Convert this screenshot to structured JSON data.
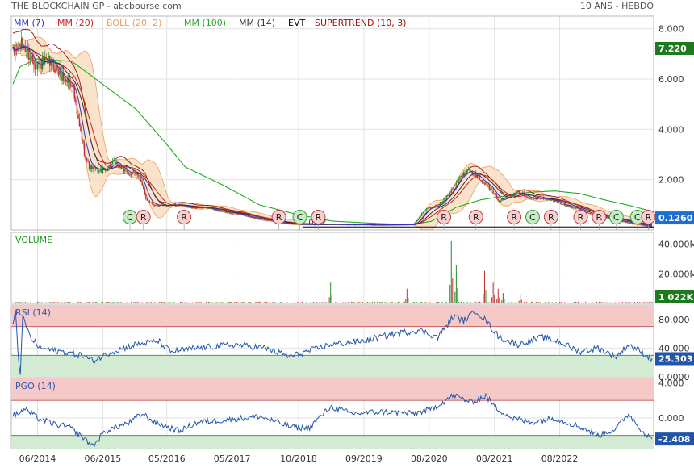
{
  "header": {
    "title": "THE BLOCKCHAIN GP - abcbourse.com",
    "period": "10 ANS - HEBDO"
  },
  "colors": {
    "mm7": "#3333cc",
    "mm20": "#cc2222",
    "boll": "#e8a060",
    "boll_fill": "#f7d9b8",
    "mm100": "#22aa22",
    "mm14": "#333333",
    "evt": "#000000",
    "supertrend": "#991111",
    "price_up": "#2a8a2a",
    "price_down": "#c03030",
    "rsi": "#2255aa",
    "pgo": "#2255aa",
    "zone_top": "#f6c9c9",
    "zone_bottom": "#d3ebd3",
    "last_price_bg": "#1f6fd1",
    "ma_tag_bg": "#1e7a1e"
  },
  "chart_data": [
    {
      "type": "line",
      "name": "price",
      "legend": [
        {
          "label": "MM (7)",
          "key": "mm7"
        },
        {
          "label": "MM (20)",
          "key": "mm20"
        },
        {
          "label": "BOLL (20, 2)",
          "key": "boll"
        },
        {
          "label": "MM (100)",
          "key": "mm100"
        },
        {
          "label": "MM (14)",
          "key": "mm14"
        },
        {
          "label": "EVT",
          "key": "evt"
        },
        {
          "label": "SUPERTREND (10, 3)",
          "key": "supertrend"
        }
      ],
      "ylim": [
        0,
        8.5
      ],
      "y_ticks": [
        {
          "v": 8,
          "label": "8.000"
        },
        {
          "v": 6,
          "label": "6.000"
        },
        {
          "v": 4,
          "label": "4.000"
        },
        {
          "v": 2,
          "label": "2.000"
        }
      ],
      "last_value": "0.1260",
      "ma_value": "7.220",
      "annotation": "0.12",
      "x_ticks": [
        "06/2014",
        "06/2015",
        "05/2016",
        "05/2017",
        "10/2018",
        "09/2019",
        "08/2020",
        "08/2021",
        "08/2022"
      ],
      "x_tick_index": [
        20,
        73,
        125,
        178,
        232,
        285,
        338,
        391,
        444
      ],
      "x_count": 520,
      "close_knots": [
        [
          0,
          7.0
        ],
        [
          8,
          7.15
        ],
        [
          18,
          6.9
        ],
        [
          28,
          6.5
        ],
        [
          40,
          6.2
        ],
        [
          48,
          6.0
        ],
        [
          52,
          4.5
        ],
        [
          58,
          3.0
        ],
        [
          62,
          2.5
        ],
        [
          75,
          2.4
        ],
        [
          82,
          2.6
        ],
        [
          95,
          2.3
        ],
        [
          102,
          2.2
        ],
        [
          108,
          1.2
        ],
        [
          115,
          1.0
        ],
        [
          140,
          0.95
        ],
        [
          165,
          0.8
        ],
        [
          190,
          0.55
        ],
        [
          210,
          0.35
        ],
        [
          232,
          0.22
        ],
        [
          260,
          0.22
        ],
        [
          300,
          0.2
        ],
        [
          325,
          0.22
        ],
        [
          335,
          0.8
        ],
        [
          345,
          1.0
        ],
        [
          355,
          1.5
        ],
        [
          365,
          2.2
        ],
        [
          370,
          2.5
        ],
        [
          380,
          2.0
        ],
        [
          395,
          1.2
        ],
        [
          410,
          1.5
        ],
        [
          420,
          1.3
        ],
        [
          440,
          1.15
        ],
        [
          460,
          0.8
        ],
        [
          480,
          0.5
        ],
        [
          500,
          0.3
        ],
        [
          510,
          0.2
        ],
        [
          518,
          0.126
        ]
      ],
      "mm100_knots": [
        [
          0,
          5.8
        ],
        [
          6,
          6.5
        ],
        [
          20,
          6.8
        ],
        [
          48,
          6.7
        ],
        [
          70,
          5.9
        ],
        [
          100,
          4.8
        ],
        [
          125,
          3.4
        ],
        [
          140,
          2.5
        ],
        [
          170,
          1.8
        ],
        [
          200,
          1.0
        ],
        [
          232,
          0.6
        ],
        [
          260,
          0.35
        ],
        [
          300,
          0.25
        ],
        [
          325,
          0.22
        ],
        [
          340,
          0.35
        ],
        [
          360,
          0.9
        ],
        [
          380,
          1.2
        ],
        [
          420,
          1.5
        ],
        [
          440,
          1.55
        ],
        [
          460,
          1.45
        ],
        [
          480,
          1.2
        ],
        [
          500,
          0.98
        ],
        [
          518,
          0.75
        ]
      ],
      "evt_markers": [
        {
          "i": 95,
          "t": "C"
        },
        {
          "i": 106,
          "t": "R"
        },
        {
          "i": 139,
          "t": "R"
        },
        {
          "i": 216,
          "t": "R"
        },
        {
          "i": 233,
          "t": "C"
        },
        {
          "i": 248,
          "t": "R"
        },
        {
          "i": 350,
          "t": "R"
        },
        {
          "i": 376,
          "t": "R"
        },
        {
          "i": 407,
          "t": "R"
        },
        {
          "i": 422,
          "t": "C"
        },
        {
          "i": 437,
          "t": "R"
        },
        {
          "i": 461,
          "t": "R"
        },
        {
          "i": 476,
          "t": "R"
        },
        {
          "i": 490,
          "t": "C"
        },
        {
          "i": 507,
          "t": "C"
        },
        {
          "i": 516,
          "t": "R"
        }
      ]
    },
    {
      "type": "bar",
      "name": "volume",
      "label": "VOLUME",
      "ylim": [
        0,
        48000
      ],
      "y_ticks": [
        {
          "v": 40000,
          "label": "40.000M"
        },
        {
          "v": 20000,
          "label": "20.000M"
        }
      ],
      "last_value": "1 022K",
      "spikes": [
        [
          258,
          14000
        ],
        [
          320,
          10000
        ],
        [
          356,
          42000
        ],
        [
          360,
          26000
        ],
        [
          383,
          22000
        ],
        [
          390,
          14000
        ],
        [
          394,
          10000
        ],
        [
          398,
          7000
        ],
        [
          412,
          6000
        ]
      ]
    },
    {
      "type": "line",
      "name": "rsi",
      "label": "RSI (14)",
      "ylim": [
        0,
        100
      ],
      "y_ticks": [
        {
          "v": 80,
          "label": "80.000"
        },
        {
          "v": 40,
          "label": "40.000"
        },
        {
          "v": 0,
          "label": "0.0000"
        }
      ],
      "zones": [
        70,
        30
      ],
      "last_value": "25.303",
      "knots": [
        [
          0,
          70
        ],
        [
          2,
          95
        ],
        [
          4,
          40
        ],
        [
          6,
          0
        ],
        [
          8,
          85
        ],
        [
          14,
          55
        ],
        [
          22,
          40
        ],
        [
          40,
          35
        ],
        [
          56,
          30
        ],
        [
          65,
          22
        ],
        [
          80,
          35
        ],
        [
          100,
          45
        ],
        [
          118,
          50
        ],
        [
          128,
          35
        ],
        [
          150,
          40
        ],
        [
          180,
          45
        ],
        [
          205,
          40
        ],
        [
          225,
          28
        ],
        [
          258,
          45
        ],
        [
          285,
          50
        ],
        [
          310,
          60
        ],
        [
          330,
          65
        ],
        [
          345,
          55
        ],
        [
          358,
          85
        ],
        [
          366,
          78
        ],
        [
          376,
          92
        ],
        [
          383,
          80
        ],
        [
          395,
          55
        ],
        [
          410,
          45
        ],
        [
          430,
          55
        ],
        [
          445,
          48
        ],
        [
          460,
          35
        ],
        [
          475,
          40
        ],
        [
          490,
          28
        ],
        [
          500,
          45
        ],
        [
          510,
          35
        ],
        [
          518,
          25.3
        ]
      ]
    },
    {
      "type": "line",
      "name": "pgo",
      "label": "PGO (14)",
      "ylim": [
        -3.5,
        4.5
      ],
      "y_ticks": [
        {
          "v": 4,
          "label": "4.000"
        },
        {
          "v": 0,
          "label": "0.000"
        }
      ],
      "zones": [
        2,
        -2
      ],
      "last_value": "-2.408",
      "knots": [
        [
          0,
          0.2
        ],
        [
          10,
          1.0
        ],
        [
          20,
          0.0
        ],
        [
          35,
          -0.8
        ],
        [
          45,
          -1.0
        ],
        [
          55,
          -2.0
        ],
        [
          65,
          -3.2
        ],
        [
          75,
          -1.5
        ],
        [
          95,
          -0.5
        ],
        [
          105,
          0.5
        ],
        [
          115,
          -0.5
        ],
        [
          135,
          -1.5
        ],
        [
          150,
          -0.5
        ],
        [
          175,
          -0.2
        ],
        [
          200,
          0.2
        ],
        [
          225,
          -1.0
        ],
        [
          240,
          -1.2
        ],
        [
          258,
          1.3
        ],
        [
          275,
          0.5
        ],
        [
          300,
          0.7
        ],
        [
          325,
          0.5
        ],
        [
          340,
          1.0
        ],
        [
          358,
          2.6
        ],
        [
          372,
          1.8
        ],
        [
          384,
          2.5
        ],
        [
          392,
          1.2
        ],
        [
          405,
          0.0
        ],
        [
          420,
          -0.5
        ],
        [
          440,
          0.0
        ],
        [
          460,
          -1.0
        ],
        [
          476,
          -2.0
        ],
        [
          490,
          -1.2
        ],
        [
          500,
          0.5
        ],
        [
          508,
          -1.0
        ],
        [
          518,
          -2.4
        ]
      ]
    }
  ]
}
